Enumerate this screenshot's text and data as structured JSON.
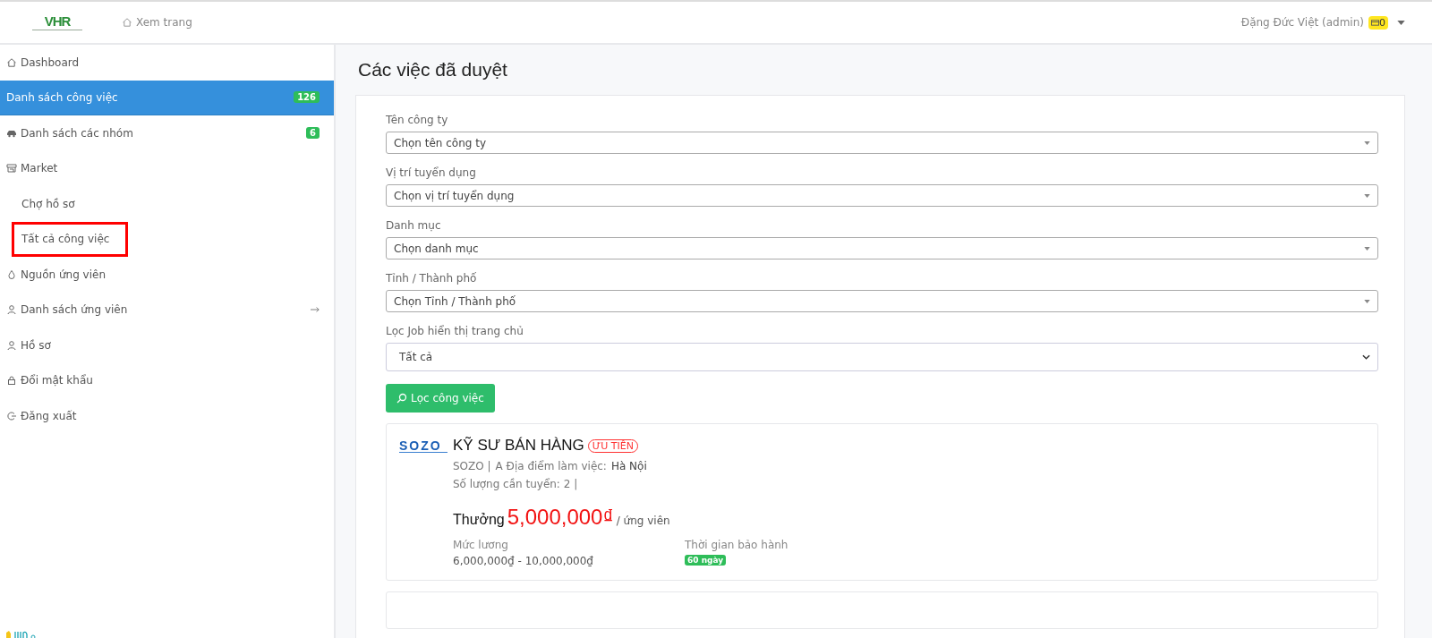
{
  "header": {
    "logo": "VHR",
    "view_site": "Xem trang",
    "user": "Đặng Đức Việt (admin)",
    "wallet_count": "0"
  },
  "sidebar": {
    "items": [
      {
        "label": "Dashboard",
        "selected": false
      },
      {
        "label": "Danh sách công việc",
        "selected": true,
        "badge": "126"
      },
      {
        "label": "Danh sách các nhóm",
        "selected": false,
        "badge": "6"
      },
      {
        "label": "Market",
        "selected": false,
        "children": [
          {
            "label": "Chợ hồ sơ",
            "selected": false,
            "highlighted": false
          },
          {
            "label": "Tất cả công việc",
            "selected": false,
            "highlighted": true
          }
        ]
      },
      {
        "label": "Nguồn ứng viên",
        "selected": false
      },
      {
        "label": "Danh sách ứng viên",
        "selected": false,
        "arrow": true
      },
      {
        "label": "Hồ sơ",
        "selected": false
      },
      {
        "label": "Đổi mật khẩu",
        "selected": false
      },
      {
        "label": "Đăng xuất",
        "selected": false
      }
    ]
  },
  "page": {
    "title": "Các việc đã duyệt",
    "filters": [
      {
        "label": "Tên công ty",
        "value": "Chọn tên công ty",
        "kind": "select2"
      },
      {
        "label": "Vị trí tuyển dụng",
        "value": "Chọn vị trí tuyển dụng",
        "kind": "select2"
      },
      {
        "label": "Danh mục",
        "value": "Chọn danh mục",
        "kind": "select2"
      },
      {
        "label": "Tỉnh / Thành phố",
        "value": "Chọn Tỉnh / Thành phố",
        "kind": "select2"
      },
      {
        "label": "Lọc Job hiển thị trang chủ",
        "value": "Tất cả",
        "kind": "native"
      }
    ],
    "filter_button": "Lọc công việc",
    "jobs": [
      {
        "logo": "SOZO",
        "title": "KỸ SƯ BÁN HÀNG",
        "tag": "ƯU TIÊN",
        "company": "SOZO |",
        "location_label": "A Địa điểm làm việc:",
        "location": "Hà Nội",
        "quantity": "Số lượng cần tuyển: 2 |",
        "bonus_label": "Thưởng",
        "bonus": "5,000,000₫",
        "bonus_unit": "/ ứng viên",
        "salary_label": "Mức lương",
        "salary": "6,000,000₫ - 10,000,000₫",
        "warranty_label": "Thời gian bảo hành",
        "warranty": "60 ngày"
      }
    ]
  }
}
